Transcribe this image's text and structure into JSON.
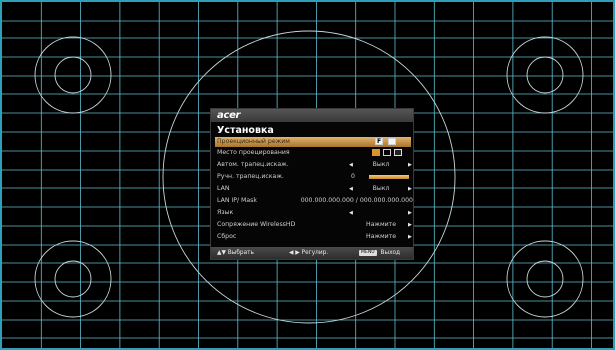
{
  "osd": {
    "logo": "acer",
    "title": "Установка",
    "rows": [
      {
        "label": "Проекционный режим",
        "selected": true
      },
      {
        "label": "Место проецирования",
        "selected": false
      },
      {
        "label": "Автом. трапец.искаж.",
        "value": "Выкл"
      },
      {
        "label": "Ручн. трапец.искаж.",
        "value": "0"
      },
      {
        "label": "LAN",
        "value": "Выкл"
      },
      {
        "label": "LAN IP/ Mask",
        "value": "000.000.000.000  /  000.000.000.000"
      },
      {
        "label": "Язык",
        "value": ""
      },
      {
        "label": "Сопряжение WirelessHD",
        "value": "Нажмите"
      },
      {
        "label": "Сброс",
        "value": "Нажмите"
      }
    ],
    "icons": {
      "front_mode_letter": "F"
    },
    "footer": {
      "select": "Выбрать",
      "adjust": "Регулир.",
      "menu_key": "MENU",
      "exit": "Выход"
    }
  },
  "colors": {
    "grid": "#5fbfd0",
    "border": "#2f9fb8",
    "highlight": "#d9a95e",
    "background": "#000000"
  }
}
